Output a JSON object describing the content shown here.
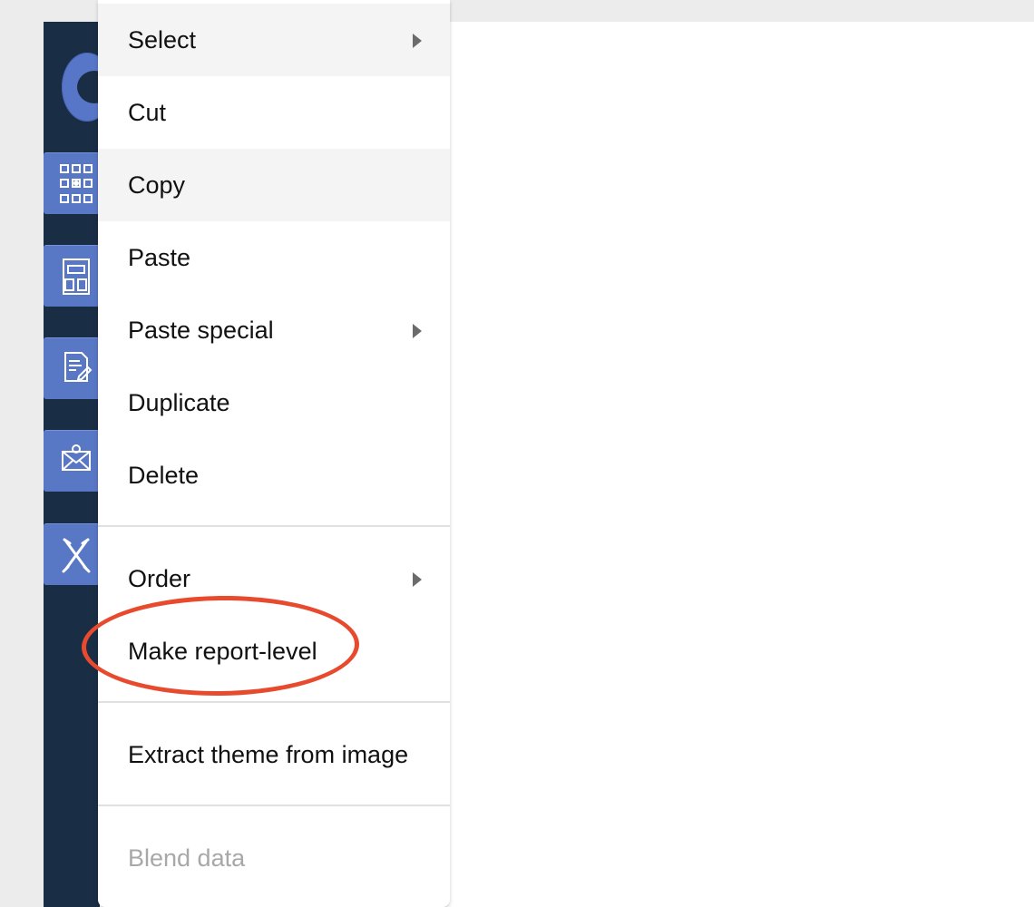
{
  "colors": {
    "sidebar_bg": "#192d45",
    "nav_tile": "#5877c4",
    "menu_text": "#111111",
    "disabled_text": "#a8a8a8",
    "highlight_oval": "#e84a2d"
  },
  "sidebar": {
    "icons": [
      "logo-ring-icon",
      "dashboard-grid-icon",
      "building-icon",
      "document-edit-icon",
      "mail-icon",
      "tools-icon"
    ]
  },
  "context_menu": {
    "items": [
      {
        "label": "Select",
        "has_submenu": true
      },
      {
        "label": "Cut",
        "has_submenu": false
      },
      {
        "label": "Copy",
        "has_submenu": false
      },
      {
        "label": "Paste",
        "has_submenu": false
      },
      {
        "label": "Paste special",
        "has_submenu": true
      },
      {
        "label": "Duplicate",
        "has_submenu": false
      },
      {
        "label": "Delete",
        "has_submenu": false
      },
      {
        "label": "Order",
        "has_submenu": true
      },
      {
        "label": "Make report-level",
        "has_submenu": false,
        "circled": true
      },
      {
        "label": "Extract theme from image",
        "has_submenu": false
      },
      {
        "label": "Blend data",
        "has_submenu": false,
        "disabled": true
      }
    ]
  }
}
